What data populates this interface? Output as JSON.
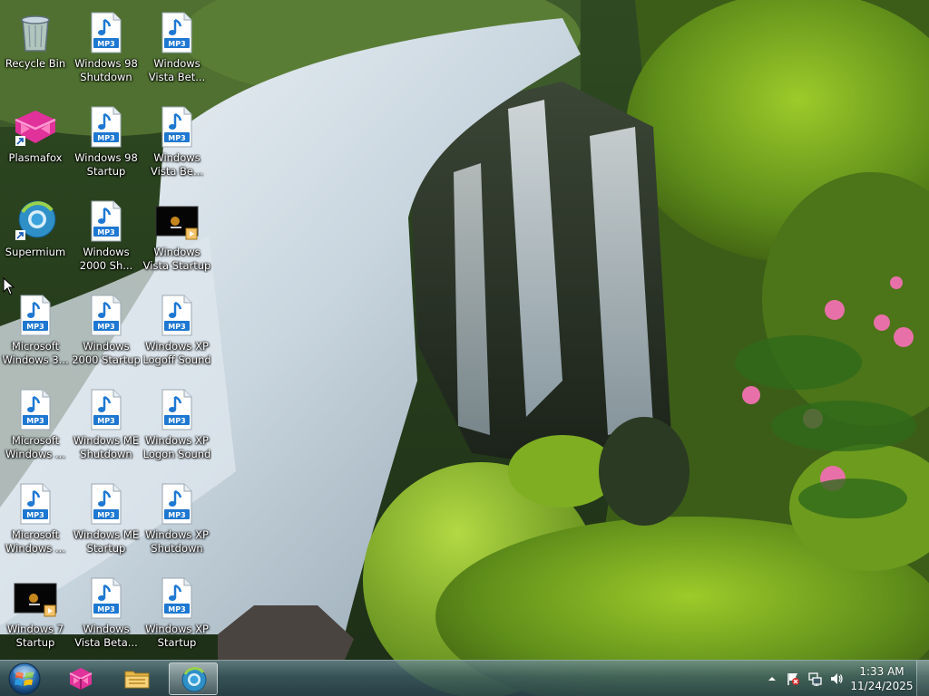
{
  "desktop": {
    "icons": [
      {
        "label": "Recycle Bin",
        "type": "recycle-bin"
      },
      {
        "label": "Plasmafox",
        "type": "plasmafox"
      },
      {
        "label": "Supermium",
        "type": "supermium"
      },
      {
        "label": "Microsoft Windows 3...",
        "type": "mp3"
      },
      {
        "label": "Microsoft Windows ...",
        "type": "mp3"
      },
      {
        "label": "Microsoft Windows ...",
        "type": "mp3"
      },
      {
        "label": "Windows 7 Startup",
        "type": "video"
      },
      {
        "label": "Windows 98 Shutdown",
        "type": "mp3"
      },
      {
        "label": "Windows 98 Startup",
        "type": "mp3"
      },
      {
        "label": "Windows 2000 Sh...",
        "type": "mp3"
      },
      {
        "label": "Windows 2000 Startup",
        "type": "mp3"
      },
      {
        "label": "Windows ME Shutdown",
        "type": "mp3"
      },
      {
        "label": "Windows ME Startup",
        "type": "mp3"
      },
      {
        "label": "Windows Vista Beta...",
        "type": "mp3"
      },
      {
        "label": "Windows Vista Bet...",
        "type": "mp3"
      },
      {
        "label": "Windows Vista Be...",
        "type": "mp3"
      },
      {
        "label": "Windows Vista Startup",
        "type": "video"
      },
      {
        "label": "Windows XP Logoff Sound",
        "type": "mp3"
      },
      {
        "label": "Windows XP Logon Sound",
        "type": "mp3"
      },
      {
        "label": "Windows XP Shutdown",
        "type": "mp3"
      },
      {
        "label": "Windows XP Startup",
        "type": "mp3"
      }
    ],
    "mp3_badge": "MP3"
  },
  "taskbar": {
    "buttons": [
      {
        "name": "plasmafox",
        "icon": "plasmafox-icon",
        "active": false
      },
      {
        "name": "file-explorer",
        "icon": "folder-icon",
        "active": false
      },
      {
        "name": "supermium",
        "icon": "supermium-icon",
        "active": true
      }
    ],
    "tray": {
      "icons": [
        "show-hidden-icons-arrow",
        "action-center-flag-icon",
        "network-icon",
        "volume-icon"
      ]
    },
    "clock": {
      "time": "1:33 AM",
      "date": "11/24/2025"
    }
  },
  "colors": {
    "taskbar_tint": "#3c5a64",
    "label_text": "#ffffff",
    "plasmafox_magenta": "#e0329a",
    "mp3_blue": "#1e78d2"
  }
}
